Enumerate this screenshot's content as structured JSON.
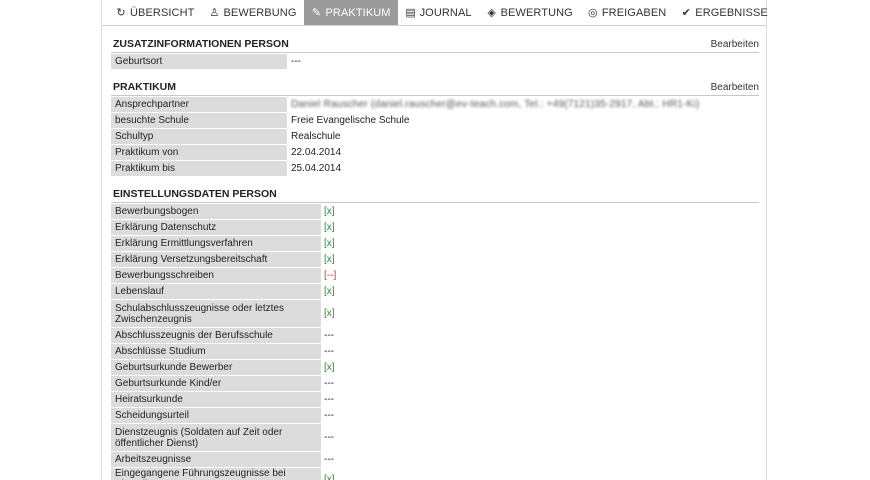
{
  "tabs": [
    {
      "label": "ÜBERSICHT",
      "icon": "refresh-icon",
      "glyph": "↻",
      "active": false
    },
    {
      "label": "BEWERBUNG",
      "icon": "person-icon",
      "glyph": "♙",
      "active": false
    },
    {
      "label": "PRAKTIKUM",
      "icon": "edit-icon",
      "glyph": "✎",
      "active": true
    },
    {
      "label": "JOURNAL",
      "icon": "journal-icon",
      "glyph": "▤",
      "active": false
    },
    {
      "label": "BEWERTUNG",
      "icon": "rating-icon",
      "glyph": "◈",
      "active": false
    },
    {
      "label": "FREIGABEN",
      "icon": "release-icon",
      "glyph": "◎",
      "active": false
    },
    {
      "label": "ERGEBNISSE",
      "icon": "check-icon",
      "glyph": "✔",
      "active": false
    }
  ],
  "zusatz": {
    "title": "ZUSATZINFORMATIONEN PERSON",
    "edit": "Bearbeiten",
    "rows": [
      {
        "label": "Geburtsort",
        "value": "---"
      }
    ]
  },
  "praktikum": {
    "title": "PRAKTIKUM",
    "edit": "Bearbeiten",
    "contact_label": "Ansprechpartner",
    "contact_value": "Daniel Rauscher (daniel.rauscher@ev-teach.com, Tel.: +49(7121)35-2917, Abt.: HR1-Ki)",
    "rows": [
      {
        "label": "besuchte Schule",
        "value": "Freie Evangelische Schule"
      },
      {
        "label": "Schultyp",
        "value": "Realschule"
      },
      {
        "label": "Praktikum von",
        "value": "22.04.2014"
      },
      {
        "label": "Praktikum bis",
        "value": "25.04.2014"
      }
    ]
  },
  "einstellung": {
    "title": "EINSTELLUNGSDATEN PERSON",
    "rows": [
      {
        "label": "Bewerbungsbogen",
        "value": "[x]",
        "status": "ok"
      },
      {
        "label": "Erklärung Datenschutz",
        "value": "[x]",
        "status": "ok"
      },
      {
        "label": "Erklärung Ermittlungsverfahren",
        "value": "[x]",
        "status": "ok"
      },
      {
        "label": "Erklärung Versetzungsbereitschaft",
        "value": "[x]",
        "status": "ok"
      },
      {
        "label": "Bewerbungsschreiben",
        "value": "[--]",
        "status": "bad"
      },
      {
        "label": "Lebenslauf",
        "value": "[x]",
        "status": "ok"
      },
      {
        "label": "Schulabschlusszeugnisse oder letztes Zwischenzeugnis",
        "value": "[x]",
        "status": "ok",
        "tall": true
      },
      {
        "label": "Abschlusszeugnis der Berufsschule",
        "value": "---",
        "status": "none"
      },
      {
        "label": "Abschlüsse Studium",
        "value": "---",
        "status": "none"
      },
      {
        "label": "Geburtsurkunde Bewerber",
        "value": "[x]",
        "status": "ok"
      },
      {
        "label": "Geburtsurkunde Kind/er",
        "value": "---",
        "status": "none"
      },
      {
        "label": "Heiratsurkunde",
        "value": "---",
        "status": "none"
      },
      {
        "label": "Scheidungsurteil",
        "value": "---",
        "status": "none"
      },
      {
        "label": "Dienstzeugnis (Soldaten auf Zeit oder öffentlicher Dienst)",
        "value": "---",
        "status": "none",
        "tall": true
      },
      {
        "label": "Arbeitszeugnisse",
        "value": "---",
        "status": "none"
      },
      {
        "label": "Eingegangene Führungszeugnisse bei Einstellung",
        "value": "[x]",
        "status": "ok"
      }
    ]
  },
  "colors": {
    "ok": "#2e8b2e",
    "bad": "#c0392b",
    "active_tab": "#9b9b9b",
    "label_bg": "#dcdcdc"
  }
}
